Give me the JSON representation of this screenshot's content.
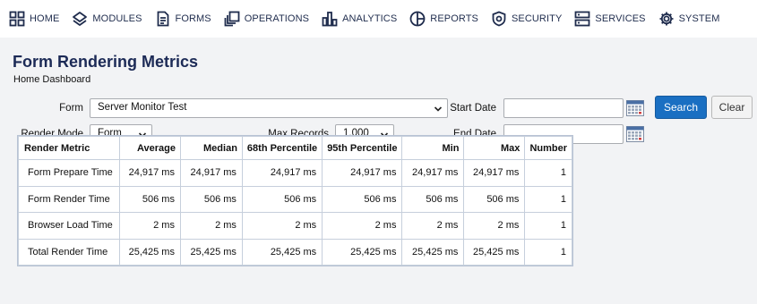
{
  "nav": {
    "items": [
      {
        "label": "HOME",
        "icon": "grid-icon"
      },
      {
        "label": "MODULES",
        "icon": "layers-icon"
      },
      {
        "label": "FORMS",
        "icon": "document-icon"
      },
      {
        "label": "OPERATIONS",
        "icon": "operations-icon"
      },
      {
        "label": "ANALYTICS",
        "icon": "bar-chart-icon"
      },
      {
        "label": "REPORTS",
        "icon": "pie-chart-icon"
      },
      {
        "label": "SECURITY",
        "icon": "shield-icon"
      },
      {
        "label": "SERVICES",
        "icon": "server-icon"
      },
      {
        "label": "SYSTEM",
        "icon": "gear-icon"
      }
    ]
  },
  "page": {
    "title": "Form Rendering Metrics",
    "subtitle": "Home Dashboard"
  },
  "filters": {
    "form_label": "Form",
    "form_value": "Server Monitor Test",
    "render_mode_label": "Render Mode",
    "render_mode_value": "Form",
    "max_records_label": "Max Records",
    "max_records_value": "1,000",
    "start_date_label": "Start Date",
    "start_date_value": "",
    "end_date_label": "End Date",
    "end_date_value": "",
    "search_label": "Search",
    "clear_label": "Clear"
  },
  "colors": {
    "accent": "#1a6fc2",
    "title": "#1c2a56",
    "background": "#f2f3f5"
  },
  "table": {
    "headers": [
      "Render Metric",
      "Average",
      "Median",
      "68th Percentile",
      "95th Percentile",
      "Min",
      "Max",
      "Number"
    ],
    "rows": [
      [
        "Form Prepare Time",
        "24,917 ms",
        "24,917 ms",
        "24,917 ms",
        "24,917 ms",
        "24,917 ms",
        "24,917 ms",
        "1"
      ],
      [
        "Form Render Time",
        "506 ms",
        "506 ms",
        "506 ms",
        "506 ms",
        "506 ms",
        "506 ms",
        "1"
      ],
      [
        "Browser Load Time",
        "2 ms",
        "2 ms",
        "2 ms",
        "2 ms",
        "2 ms",
        "2 ms",
        "1"
      ],
      [
        "Total Render Time",
        "25,425 ms",
        "25,425 ms",
        "25,425 ms",
        "25,425 ms",
        "25,425 ms",
        "25,425 ms",
        "1"
      ]
    ]
  }
}
